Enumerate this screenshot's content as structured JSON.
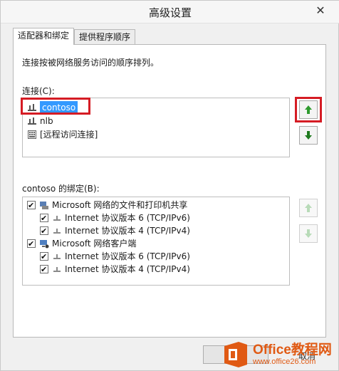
{
  "window": {
    "title": "高级设置",
    "close_glyph": "✕"
  },
  "tabs": [
    {
      "label": "适配器和绑定"
    },
    {
      "label": "提供程序顺序"
    }
  ],
  "panel": {
    "description": "连接按被网络服务访问的顺序排列。",
    "connections_label": "连接(C):",
    "connections": [
      {
        "label": "contoso"
      },
      {
        "label": "nlb"
      },
      {
        "label": "[远程访问连接]"
      }
    ],
    "bindings_label": "contoso 的绑定(B):",
    "bindings": [
      {
        "label": "Microsoft 网络的文件和打印机共享"
      },
      {
        "label": "Internet 协议版本 6 (TCP/IPv6)"
      },
      {
        "label": "Internet 协议版本 4 (TCP/IPv4)"
      },
      {
        "label": "Microsoft 网络客户端"
      },
      {
        "label": "Internet 协议版本 6 (TCP/IPv6)"
      },
      {
        "label": "Internet 协议版本 4 (TCP/IPv4)"
      }
    ]
  },
  "footer": {
    "cancel_partial": "取消"
  },
  "watermark": {
    "brand": "Office教程网",
    "url": "www.office26.com"
  },
  "colors": {
    "accent": "#3399ff",
    "highlight": "#d51c24",
    "arrow_up": "#2e9b2e",
    "arrow_down": "#1f7a1f",
    "brand": "#e05a14"
  }
}
